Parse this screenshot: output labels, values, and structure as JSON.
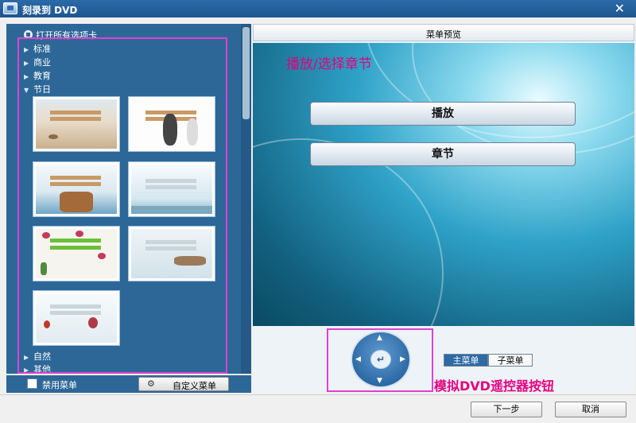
{
  "window": {
    "title": "刻录到 DVD",
    "close_glyph": "✕"
  },
  "left_panel": {
    "open_all_label": "打开所有选项卡",
    "categories_top": [
      {
        "label": "标准",
        "arrow": "▶"
      },
      {
        "label": "商业",
        "arrow": "▶"
      },
      {
        "label": "教育",
        "arrow": "▶"
      },
      {
        "label": "节日",
        "arrow": "▼"
      }
    ],
    "categories_bottom": [
      {
        "label": "自然",
        "arrow": "▶"
      },
      {
        "label": "其他",
        "arrow": "▶"
      }
    ],
    "disable_menu_label": "禁用菜单",
    "custom_menu_label": "自定义菜单",
    "gear_glyph": "⚙"
  },
  "right_panel": {
    "header": "菜单预览",
    "preview_heading": "播放/选择章节",
    "menu_buttons": [
      "播放",
      "章节"
    ],
    "remote": {
      "ok_glyph": "↵",
      "up": "▲",
      "down": "▼",
      "left": "◀",
      "right": "▶"
    },
    "tabs": {
      "main": "主菜单",
      "sub": "子菜单"
    },
    "remote_caption": "模拟DVD遥控器按钮"
  },
  "footer": {
    "next": "下一步",
    "cancel": "取消"
  },
  "colors": {
    "panel_blue": "#2c6797",
    "highlight_magenta": "#e040d0",
    "annotation_pink": "#e4007f"
  }
}
